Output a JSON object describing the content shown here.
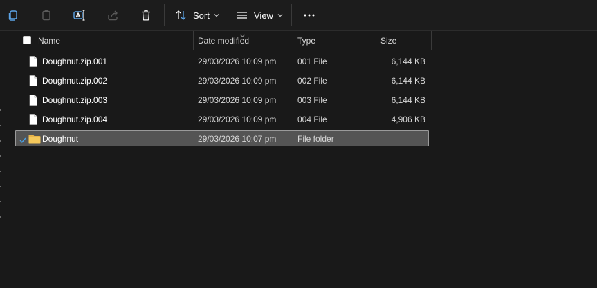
{
  "toolbar": {
    "sort_label": "Sort",
    "view_label": "View",
    "more_label": "..."
  },
  "columns": {
    "name": "Name",
    "date": "Date modified",
    "type": "Type",
    "size": "Size"
  },
  "files": [
    {
      "name": "Doughnut.zip.001",
      "date": "29/03/2026 10:09 pm",
      "type": "001 File",
      "size": "6,144 KB",
      "icon": "file-icon"
    },
    {
      "name": "Doughnut.zip.002",
      "date": "29/03/2026 10:09 pm",
      "type": "002 File",
      "size": "6,144 KB",
      "icon": "file-icon"
    },
    {
      "name": "Doughnut.zip.003",
      "date": "29/03/2026 10:09 pm",
      "type": "003 File",
      "size": "6,144 KB",
      "icon": "file-icon"
    },
    {
      "name": "Doughnut.zip.004",
      "date": "29/03/2026 10:09 pm",
      "type": "004 File",
      "size": "4,906 KB",
      "icon": "file-icon"
    },
    {
      "name": "Doughnut",
      "date": "29/03/2026 10:07 pm",
      "type": "File folder",
      "size": "",
      "icon": "folder-icon",
      "selected": true
    }
  ],
  "colors": {
    "background": "#191919",
    "selection": "#545454",
    "accent": "#4aa3e8",
    "folder": "#e8b44a"
  }
}
